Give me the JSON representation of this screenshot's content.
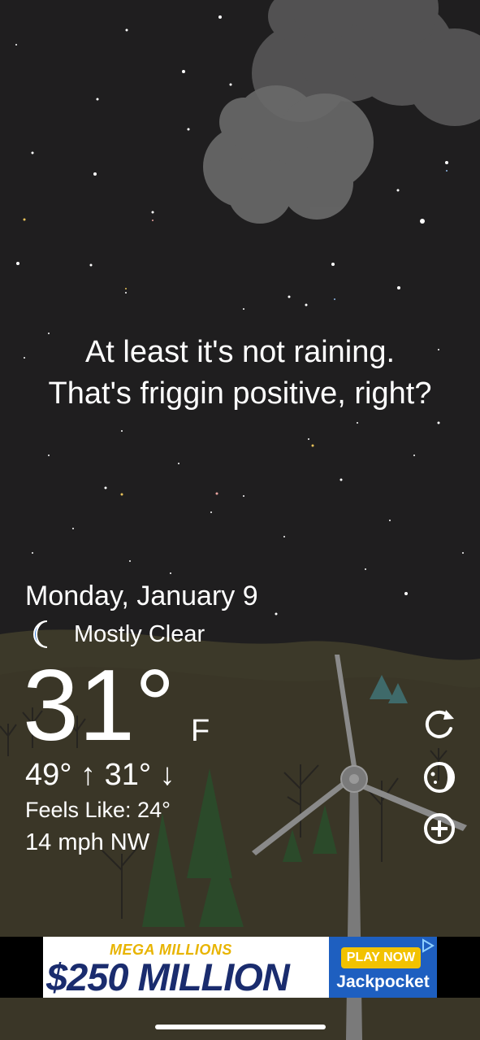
{
  "quote": {
    "line1": "At least it's not raining.",
    "line2": "That's friggin positive, right?"
  },
  "weather": {
    "date": "Monday, January 9",
    "condition_icon": "crescent-moon-icon",
    "condition": "Mostly Clear",
    "temperature": "31°",
    "unit": "F",
    "high": "49°",
    "low": "31°",
    "feels_like": "Feels Like: 24°",
    "wind": "14 mph NW"
  },
  "actions": [
    {
      "icon": "refresh-icon"
    },
    {
      "icon": "moon-phase-icon"
    },
    {
      "icon": "add-circle-icon"
    }
  ],
  "ad": {
    "headline": "MEGA MILLIONS",
    "amount": "$250 MILLION",
    "cta": "PLAY NOW",
    "brand": "Jackpocket",
    "colors": {
      "gold": "#e8b400",
      "navy": "#1a2c6e",
      "blue": "#1e5fc0"
    }
  },
  "theme": {
    "sky": "#1f1e1f",
    "ground": "#3a3626",
    "tree": "#2b4a2a"
  }
}
